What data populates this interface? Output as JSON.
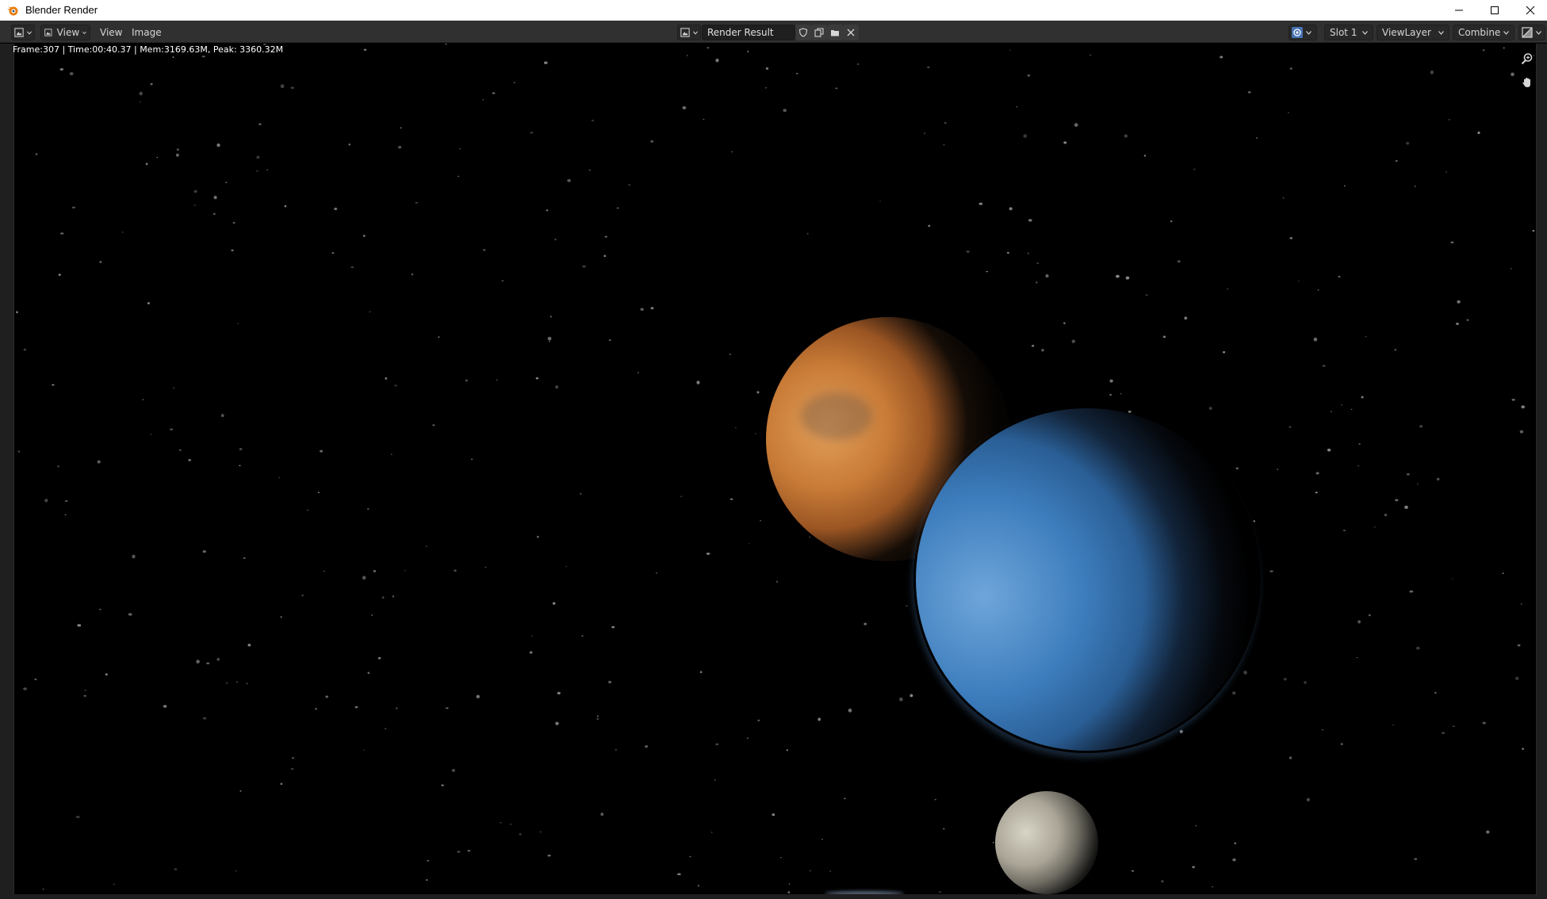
{
  "window": {
    "title": "Blender Render"
  },
  "header": {
    "menus": [
      "View",
      "View",
      "Image"
    ],
    "image_name": "Render Result",
    "slot": "Slot 1",
    "view_layer": "ViewLayer",
    "render_pass": "Combined"
  },
  "stats": "Frame:307 | Time:00:40.37 | Mem:3169.63M, Peak: 3360.32M",
  "icons": {
    "app": "blender-icon",
    "editor_type": "image-editor-icon",
    "view_toggle": "image-view-icon",
    "browse": "image-browse-icon",
    "fake_user": "shield-icon",
    "new": "duplicate-icon",
    "open": "folder-icon",
    "unlink": "close-icon",
    "display_channels": "color-channels-icon",
    "overlay": "overlay-icon",
    "zoom": "zoom-icon",
    "pan": "hand-icon"
  },
  "colors": {
    "header_bg": "#303030",
    "viewport_bg": "#000000",
    "accent_blue": "#4772b3"
  }
}
